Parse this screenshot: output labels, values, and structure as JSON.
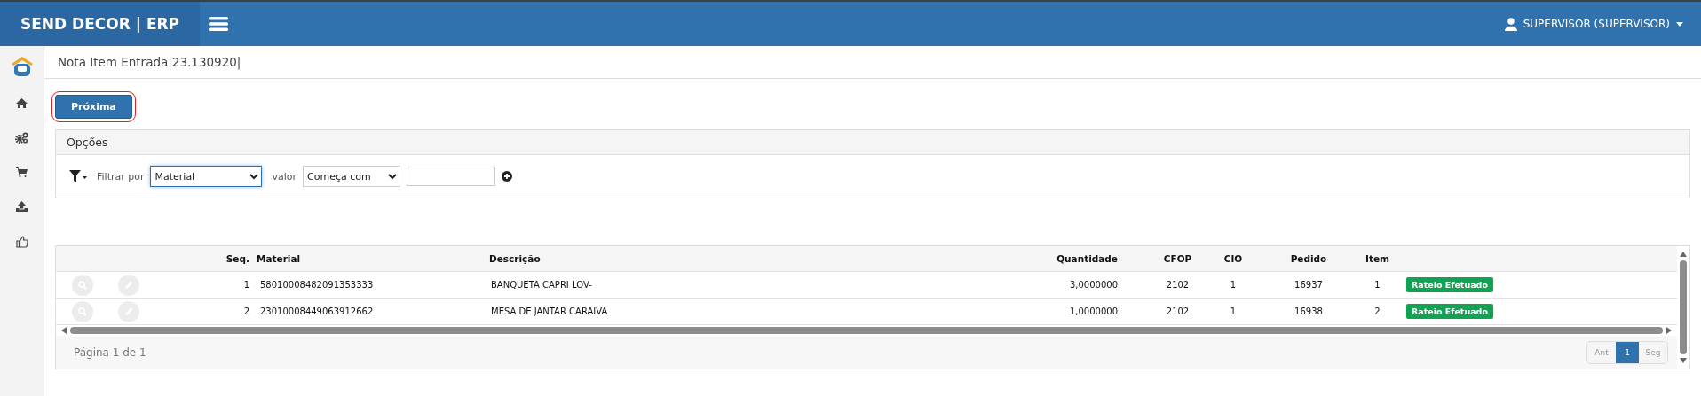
{
  "app": {
    "brand": "SEND DECOR | ERP",
    "user": "SUPERVISOR (SUPERVISOR)"
  },
  "page_title": "Nota Item Entrada|23.130920|",
  "next_button": {
    "label": "Próxima",
    "highlighted": true
  },
  "options": {
    "title": "Opções",
    "filter_label": "Filtrar por",
    "filter_field": "Material",
    "value_label": "valor",
    "match_mode": "Começa com"
  },
  "table": {
    "columns": [
      "Seq.",
      "Material",
      "Descrição",
      "Quantidade",
      "CFOP",
      "CIO",
      "Pedido",
      "Item"
    ],
    "rows": [
      {
        "cells": [
          "1",
          "58010008482091353333",
          "BANQUETA CAPRI LOV-",
          "3,0000000",
          "2102",
          "1",
          "16937",
          "1"
        ],
        "status": "Rateio Efetuado",
        "color": "#10a354"
      },
      {
        "cells": [
          "2",
          "23010008449063912662",
          "MESA DE JANTAR CARAIVA",
          "1,0000000",
          "2102",
          "1",
          "16938",
          "2"
        ],
        "status": "Rateio Efetuado",
        "color": "#10a354"
      }
    ]
  },
  "pagination": {
    "summary": "Página 1 de 1",
    "prev": {
      "label": "Ant",
      "disabled": true
    },
    "pages": [
      {
        "label": "1",
        "selected": true
      }
    ],
    "next": {
      "label": "Seg",
      "disabled": true
    }
  }
}
